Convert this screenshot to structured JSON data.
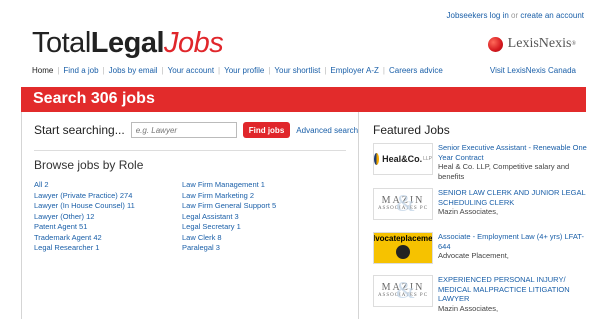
{
  "header": {
    "top_links": {
      "login": "Jobseekers log in",
      "or": "or",
      "create": "create an account"
    },
    "logo": {
      "part1": "Total",
      "part2": "Legal",
      "part3": "Jobs"
    },
    "partner": {
      "name": "LexisNexis",
      "mark": "®"
    }
  },
  "nav": {
    "items": [
      {
        "label": "Home"
      },
      {
        "label": "Find a job"
      },
      {
        "label": "Jobs by email"
      },
      {
        "label": "Your account"
      },
      {
        "label": "Your profile"
      },
      {
        "label": "Your shortlist"
      },
      {
        "label": "Employer A-Z"
      },
      {
        "label": "Careers advice"
      }
    ],
    "right_link": "Visit LexisNexis Canada"
  },
  "banner": {
    "title": "Search 306 jobs"
  },
  "search": {
    "label": "Start searching...",
    "placeholder": "e.g. Lawyer",
    "button": "Find jobs",
    "advanced": "Advanced search"
  },
  "browse": {
    "title": "Browse jobs by Role",
    "col1": [
      "All 2",
      "Lawyer (Private Practice) 274",
      "Lawyer (In House Counsel) 11",
      "Lawyer (Other) 12",
      "Patent Agent 51",
      "Trademark Agent 42",
      "Legal Researcher 1"
    ],
    "col2": [
      "Law Firm Management 1",
      "Law Firm Marketing 2",
      "Law Firm General Support 5",
      "Legal Assistant 3",
      "Legal Secretary 1",
      "Law Clerk 8",
      "Paralegal 3"
    ]
  },
  "featured": {
    "title": "Featured Jobs",
    "jobs": [
      {
        "title": "Senior Executive Assistant - Renewable One Year Contract",
        "company": "Heal & Co. LLP, Competitive salary and benefits",
        "logo": {
          "name": "Heal&Co.",
          "suffix": "LLP"
        }
      },
      {
        "title": "SENIOR LAW CLERK AND JUNIOR LEGAL SCHEDULING CLERK",
        "company": "Mazin Associates,",
        "logo": {
          "name": "MAZIN",
          "sub": "ASSOCIATES PC"
        }
      },
      {
        "title": "Associate - Employment Law (4+ yrs) LFAT-644",
        "company": "Advocate Placement,",
        "logo": {
          "name": "advocateplacement"
        }
      },
      {
        "title": "EXPERIENCED PERSONAL INJURY/ MEDICAL MALPRACTICE LITIGATION LAWYER",
        "company": "Mazin Associates,",
        "logo": {
          "name": "MAZIN",
          "sub": "ASSOCIATES PC"
        }
      }
    ]
  }
}
